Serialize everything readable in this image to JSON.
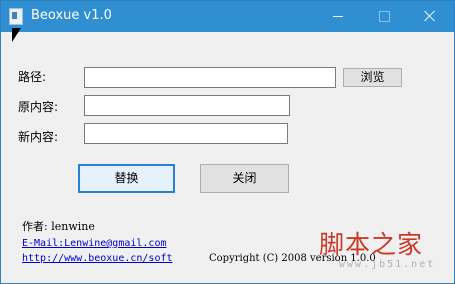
{
  "window": {
    "title": "Beoxue v1.0",
    "controls": {
      "minimize": "minimize",
      "maximize": "maximize",
      "close": "close"
    }
  },
  "form": {
    "path_label": "路径:",
    "path_value": "",
    "browse_label": "浏览",
    "original_label": "原内容:",
    "original_value": "",
    "new_label": "新内容:",
    "new_value": ""
  },
  "actions": {
    "replace_label": "替换",
    "close_label": "关闭"
  },
  "footer": {
    "author": "作者: lenwine",
    "email": "E-Mail:Lenwine@gmail.com",
    "website": "http://www.beoxue.cn/soft",
    "copyright": "Copyright (C) 2008 version 1.0.0"
  },
  "watermark": {
    "main": "脚本之家",
    "sub": "www.jb51.net"
  }
}
